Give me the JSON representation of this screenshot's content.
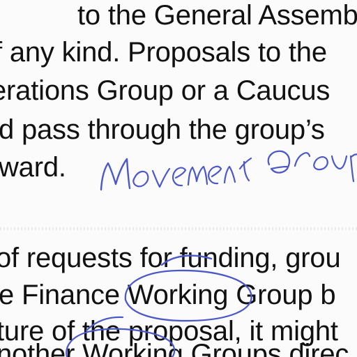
{
  "document": {
    "paragraph_1": [
      "to the General Assembly ca",
      "f any kind. Proposals to the",
      "erations Group or a Caucus",
      "d pass through the group’s",
      "ward."
    ],
    "paragraph_2": [
      "of requests for funding, grou",
      "e Finance Working Group b",
      "ture of the proposal, it might",
      "nother Working Groups direc"
    ]
  },
  "handwriting": {
    "note": "Movement Group",
    "ink_color": "#4b59c8"
  }
}
